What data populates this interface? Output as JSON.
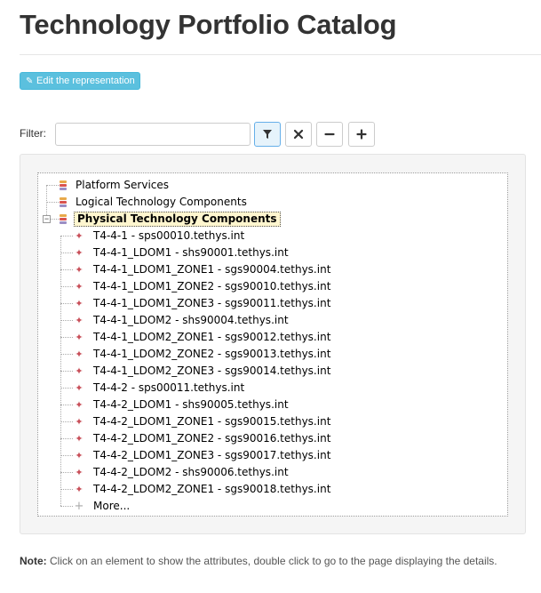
{
  "page": {
    "title": "Technology Portfolio Catalog",
    "edit_button": "Edit the representation"
  },
  "filter": {
    "label": "Filter:",
    "value": "",
    "buttons": [
      "filter-icon",
      "close-icon",
      "minus-icon",
      "plus-icon"
    ]
  },
  "tree": {
    "roots": [
      {
        "label": "Platform Services",
        "icon": "stack-icon"
      },
      {
        "label": "Logical Technology Components",
        "icon": "stack-icon"
      },
      {
        "label": "Physical Technology Components",
        "icon": "stack-icon",
        "expanded": true,
        "selected": true
      }
    ],
    "children": [
      "T4-4-1 - sps00010.tethys.int",
      "T4-4-1_LDOM1 - shs90001.tethys.int",
      "T4-4-1_LDOM1_ZONE1 - sgs90004.tethys.int",
      "T4-4-1_LDOM1_ZONE2 - sgs90010.tethys.int",
      "T4-4-1_LDOM1_ZONE3 - sgs90011.tethys.int",
      "T4-4-1_LDOM2 - shs90004.tethys.int",
      "T4-4-1_LDOM2_ZONE1 - sgs90012.tethys.int",
      "T4-4-1_LDOM2_ZONE2 - sgs90013.tethys.int",
      "T4-4-1_LDOM2_ZONE3 - sgs90014.tethys.int",
      "T4-4-2 - sps00011.tethys.int",
      "T4-4-2_LDOM1 - shs90005.tethys.int",
      "T4-4-2_LDOM1_ZONE1 - sgs90015.tethys.int",
      "T4-4-2_LDOM1_ZONE2 - sgs90016.tethys.int",
      "T4-4-2_LDOM1_ZONE3 - sgs90017.tethys.int",
      "T4-4-2_LDOM2 - shs90006.tethys.int",
      "T4-4-2_LDOM2_ZONE1 - sgs90018.tethys.int"
    ],
    "more": "More..."
  },
  "note": {
    "prefix": "Note:",
    "text": " Click on an element to show the attributes, double click to go to the page displaying the details."
  },
  "colors": {
    "accent": "#5bc0de",
    "stack": [
      "#e8a94a",
      "#d9534f",
      "#9b8ec4"
    ],
    "component": "#c8505a"
  }
}
